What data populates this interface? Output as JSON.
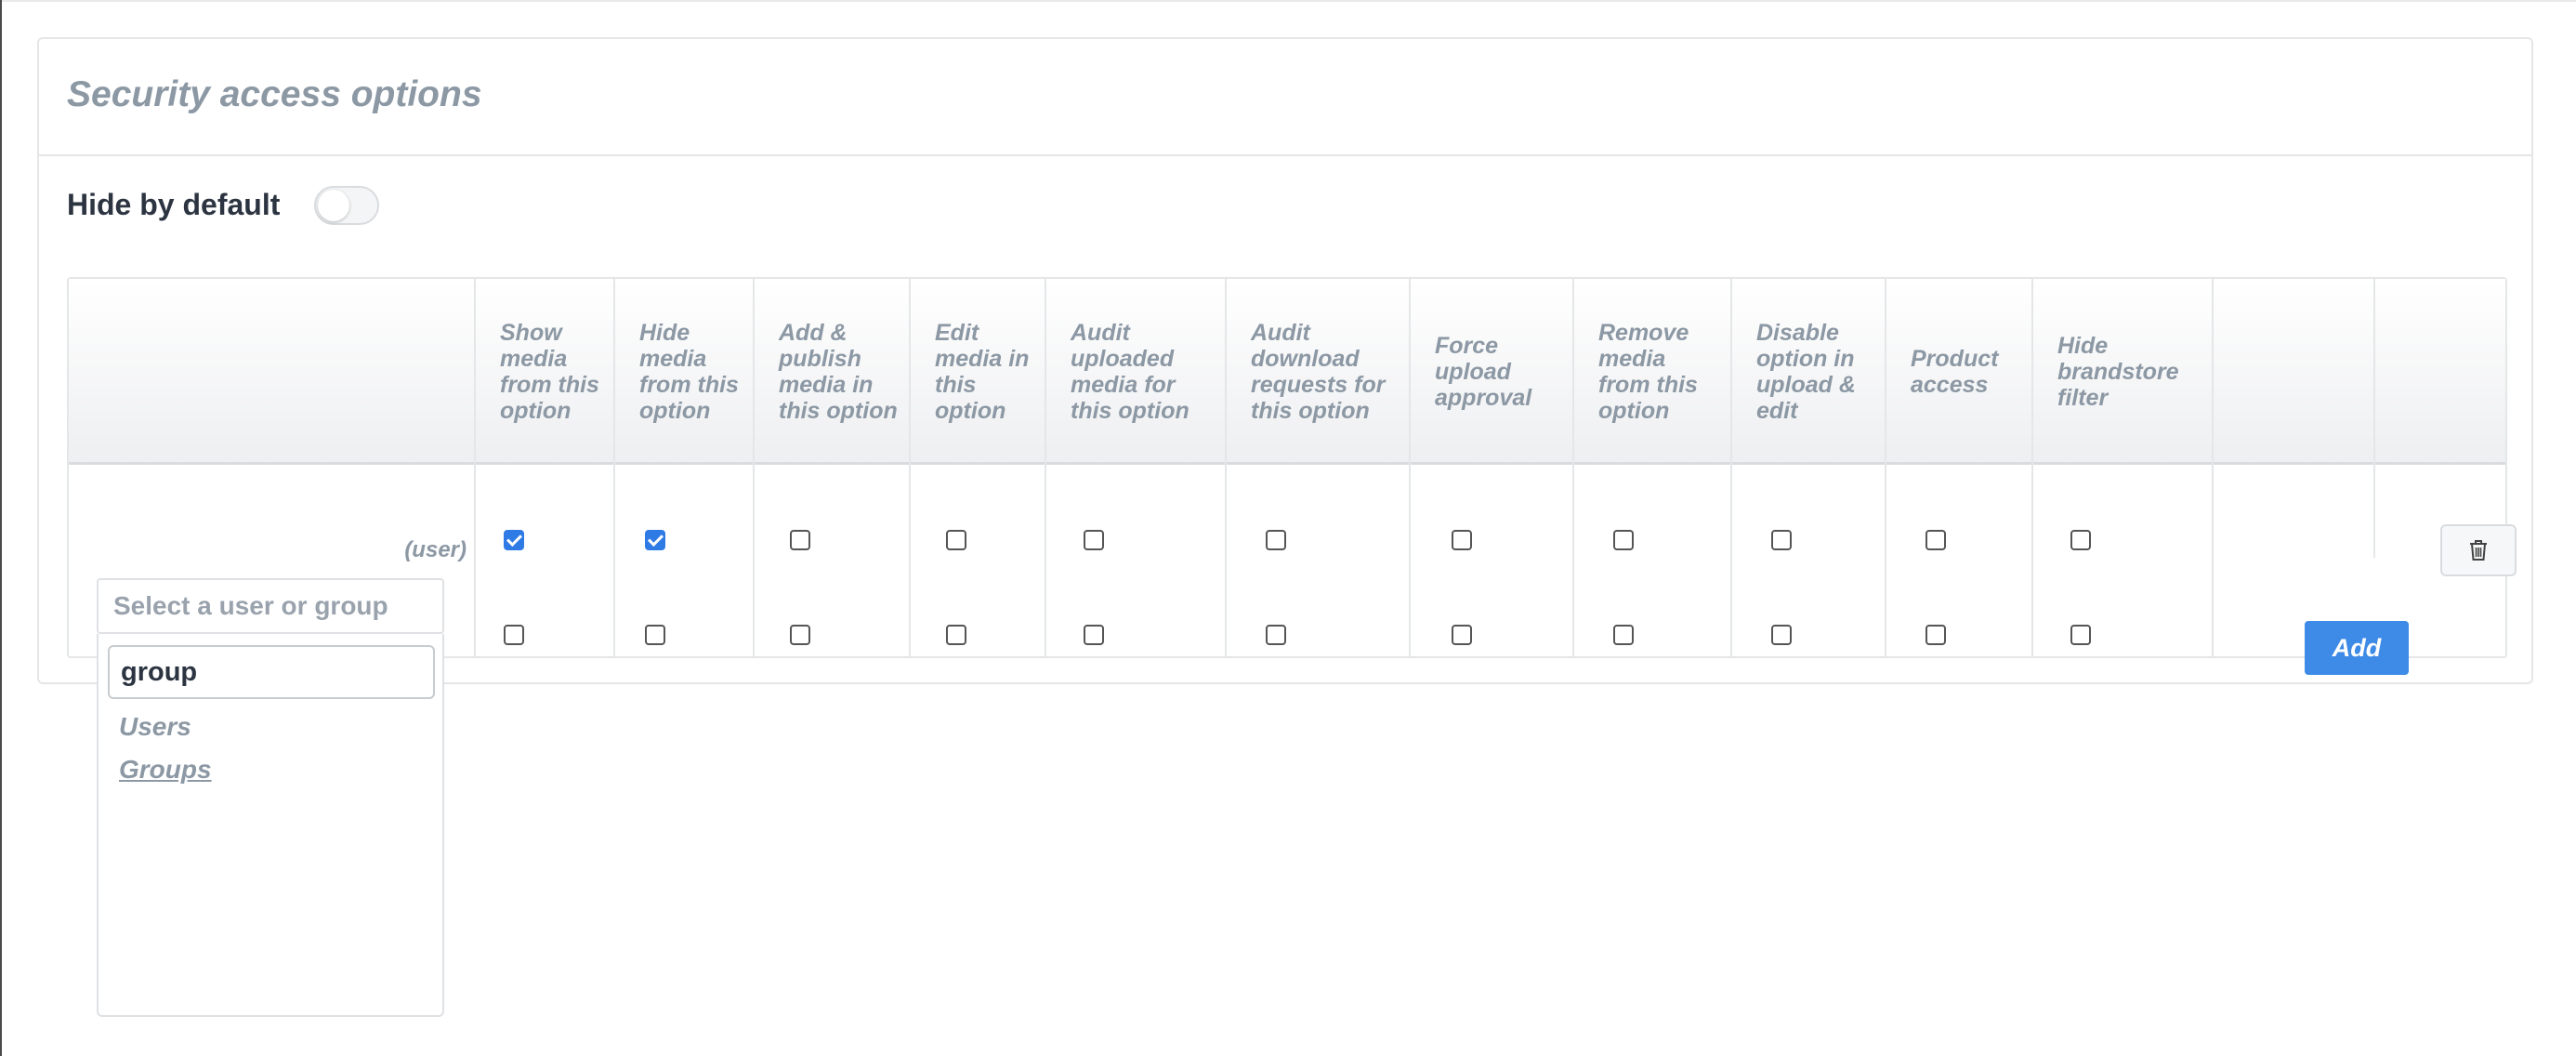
{
  "panel": {
    "title": "Security access options",
    "hide_by_default_label": "Hide by default",
    "hide_by_default_on": false
  },
  "table": {
    "columns": [
      "Show media from this option",
      "Hide media from this option",
      "Add & publish media in this option",
      "Edit media in this option",
      "Audit uploaded media for this option",
      "Audit download requests for this option",
      "Force upload approval",
      "Remove media from this option",
      "Disable option in upload & edit",
      "Product access",
      "Hide brandstore filter"
    ],
    "rows": [
      {
        "label": "(user)",
        "checks": [
          true,
          true,
          false,
          false,
          false,
          false,
          false,
          false,
          false,
          false,
          false
        ]
      }
    ],
    "new_row": {
      "select_placeholder": "Select a user or group",
      "checks": [
        false,
        false,
        false,
        false,
        false,
        false,
        false,
        false,
        false,
        false,
        false
      ],
      "add_label": "Add"
    }
  },
  "dropdown": {
    "search_value": "group",
    "options": [
      "Users",
      "Groups"
    ]
  },
  "icons": {
    "delete": "trash-icon"
  },
  "colors": {
    "accent": "#3d8be6",
    "checkbox": "#2f7be5",
    "muted_text": "#8c98a4"
  }
}
